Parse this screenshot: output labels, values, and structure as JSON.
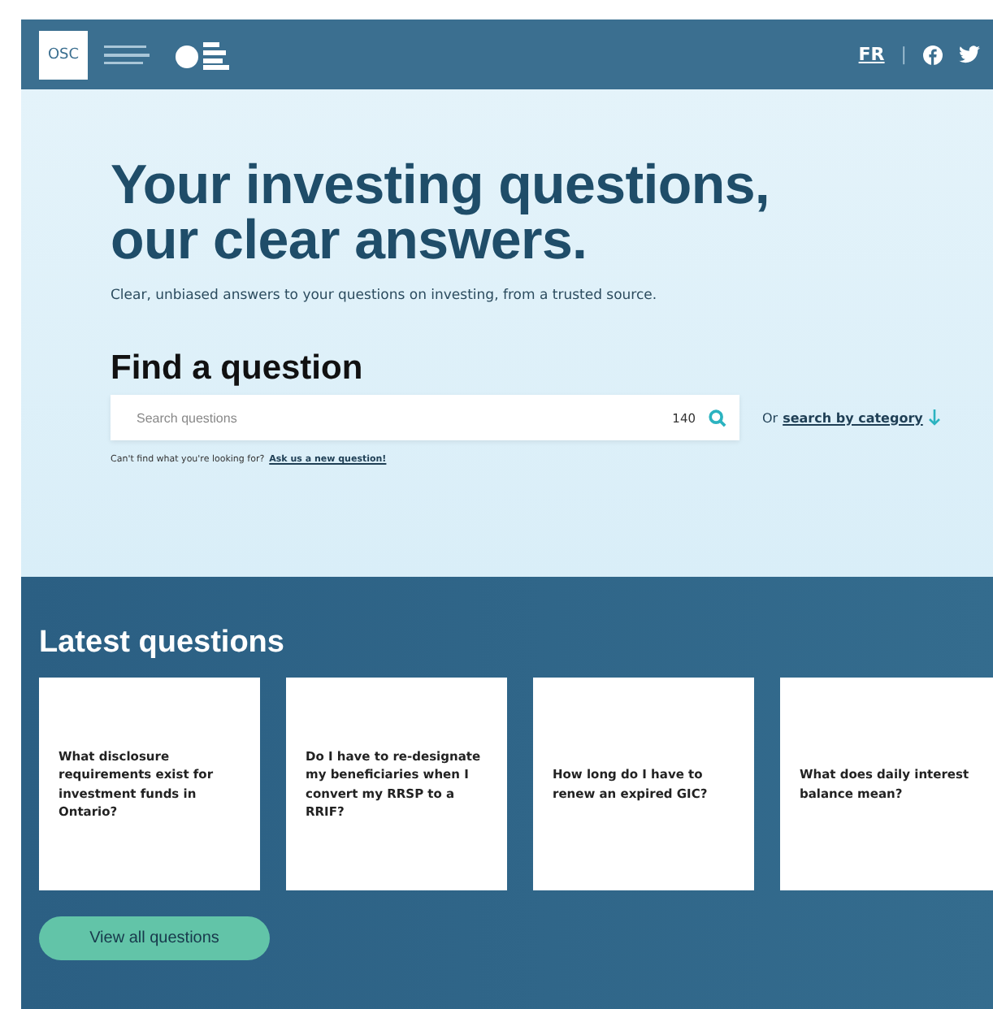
{
  "header": {
    "logo_text": "OSC",
    "language_link": "FR",
    "divider": "|"
  },
  "hero": {
    "title_line_1": "Your investing questions,",
    "title_line_2": "our clear answers.",
    "subtitle": "Clear, unbiased answers to your questions on investing, from a trusted source."
  },
  "search": {
    "heading": "Find a question",
    "placeholder": "Search questions",
    "counter": "140",
    "alt_prefix": "Or",
    "alt_link": "search by category",
    "help_text": "Can't find what you're looking for?",
    "help_link": "Ask us a new question!"
  },
  "latest": {
    "heading": "Latest questions",
    "cards": [
      {
        "question": "What disclosure requirements exist for investment funds in Ontario?"
      },
      {
        "question": "Do I have to re-designate my beneficiaries when I convert my RRSP to a RRIF?"
      },
      {
        "question": "How long do I have to renew an expired GIC?"
      },
      {
        "question": "What does daily interest balance mean?"
      }
    ],
    "button": "View all questions"
  }
}
